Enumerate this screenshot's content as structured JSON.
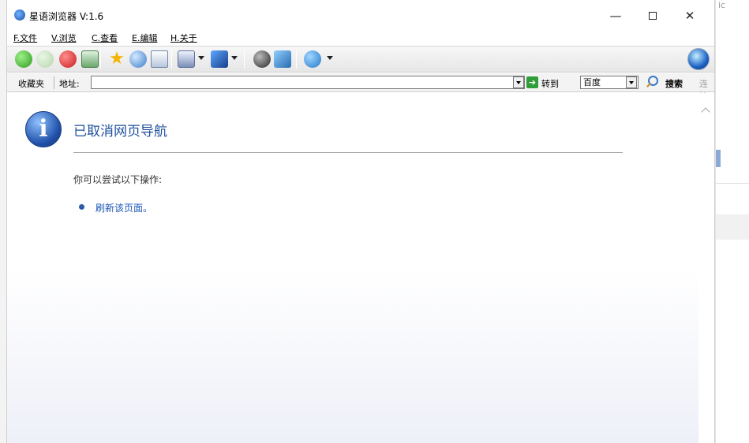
{
  "window": {
    "title": "星语浏览器 V:1.6",
    "controls": {
      "minimize": "—",
      "close": "✕"
    }
  },
  "menu": {
    "items": [
      {
        "label": "F.文件"
      },
      {
        "label": "V.浏览"
      },
      {
        "label": "C.查看"
      },
      {
        "label": "E.编辑"
      },
      {
        "label": "H.关于"
      }
    ]
  },
  "toolbar": {
    "fav_star": "★",
    "buttons": [
      "back-icon",
      "forward-icon",
      "stop-icon",
      "refresh-icon",
      "favorites-star-icon",
      "home-icon",
      "copy-icon",
      "print-icon",
      "edit-icon",
      "history-icon",
      "tools-icon",
      "sync-icon"
    ]
  },
  "addressbar": {
    "favorites_label": "收藏夹",
    "address_label": "地址:",
    "address_value": "",
    "goto_arrow": "➔",
    "goto_label": "转到",
    "engine_value": "百度",
    "search_label": "搜索",
    "connect_label": "连接"
  },
  "page": {
    "info_glyph": "i",
    "heading": "已取消网页导航",
    "try_text": "你可以尝试以下操作:",
    "refresh_link": "刷新该页面。"
  },
  "background": {
    "right_edge_text": "ic"
  },
  "colors": {
    "heading": "#1e4f9c",
    "link": "#1e57b7",
    "accent_blue": "#2a5aa8"
  }
}
